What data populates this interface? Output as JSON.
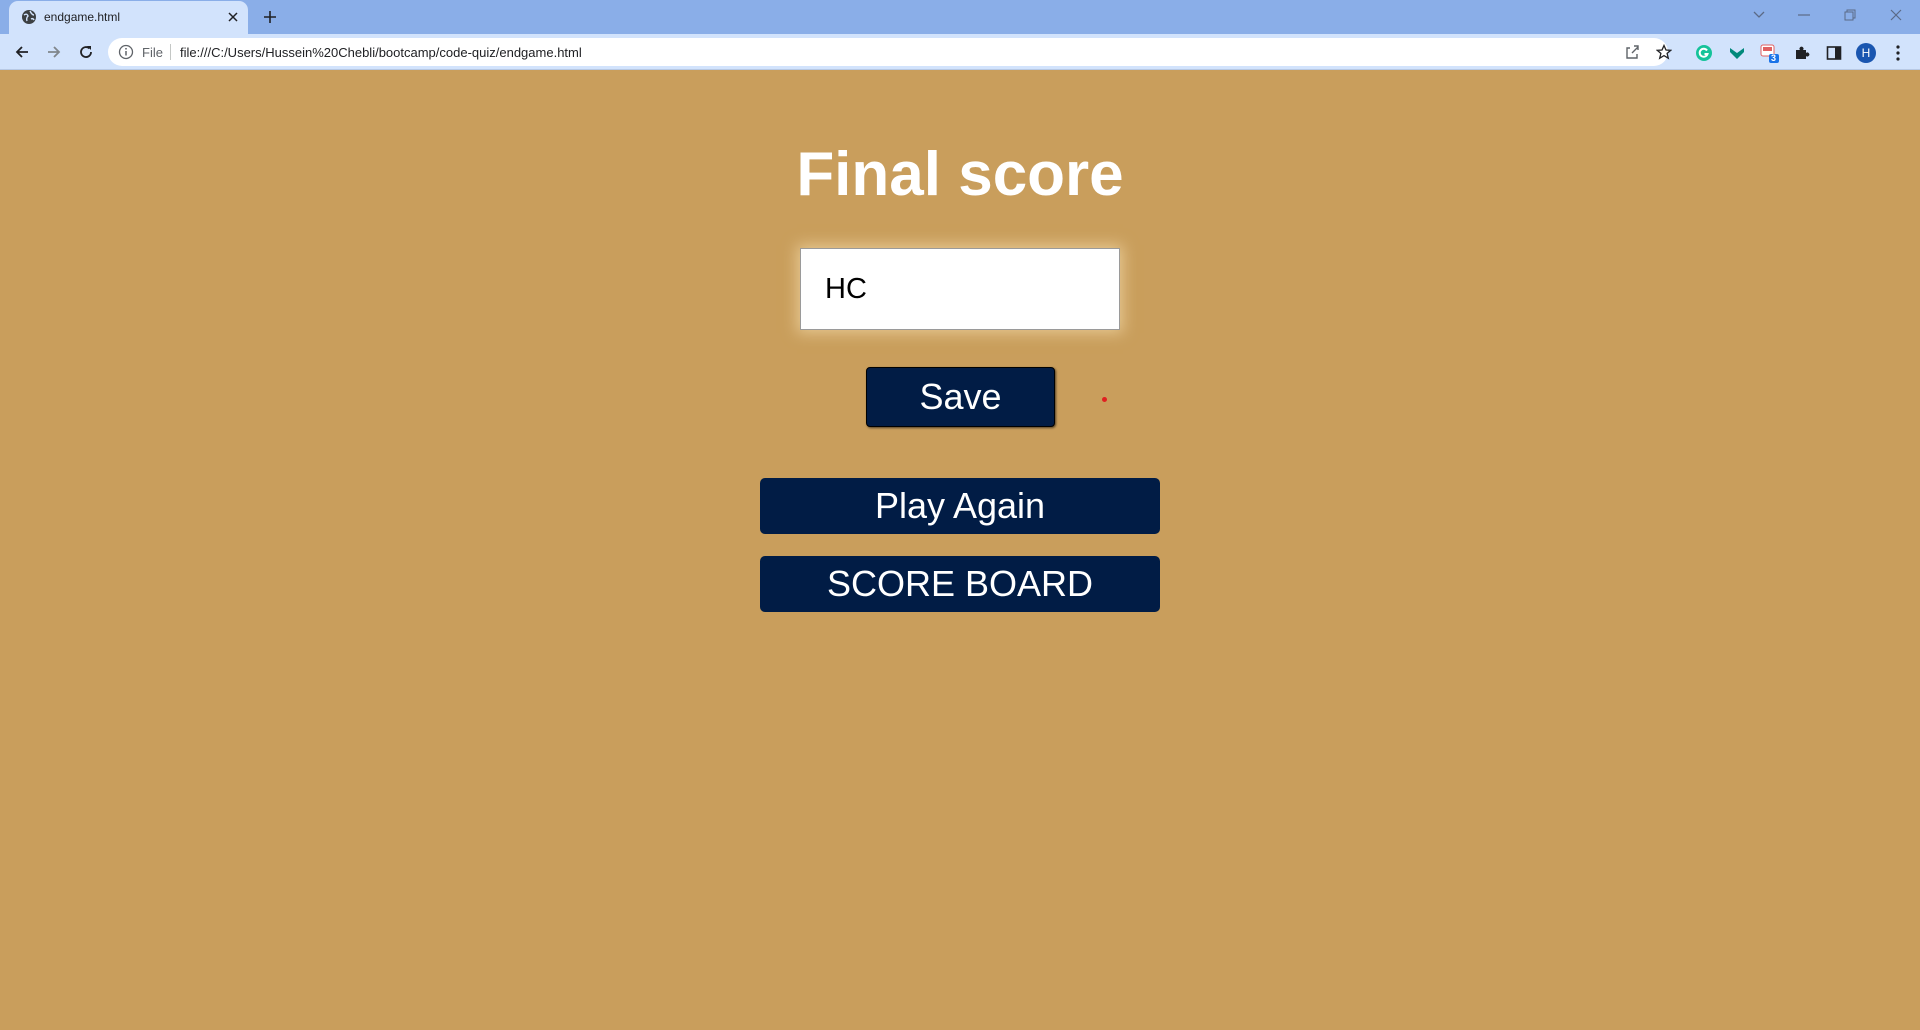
{
  "browser": {
    "tab": {
      "title": "endgame.html"
    },
    "address_bar": {
      "scheme_label": "File",
      "url": "file:///C:/Users/Hussein%20Chebli/bootcamp/code-quiz/endgame.html"
    },
    "profile_initial": "H",
    "extension_badge": "3",
    "icons": [
      "globe-icon",
      "close-icon",
      "plus-icon",
      "chevron-down-icon",
      "minimize-icon",
      "restore-icon",
      "close-window-icon",
      "back-arrow-icon",
      "forward-arrow-icon",
      "reload-icon",
      "info-icon",
      "share-icon",
      "star-icon",
      "grammarly-icon",
      "extension-download-icon",
      "extension-badge-icon",
      "puzzle-icon",
      "side-panel-icon",
      "kebab-menu-icon"
    ]
  },
  "page": {
    "title": "Final score",
    "initials_input": {
      "value": "HC"
    },
    "save_label": "Save",
    "play_again_label": "Play Again",
    "scoreboard_label": "SCORE BOARD"
  },
  "colors": {
    "page_background": "#c99e5c",
    "button_background": "#011c45",
    "tab_strip": "#8aaee8",
    "toolbar": "#d2e3fc"
  }
}
